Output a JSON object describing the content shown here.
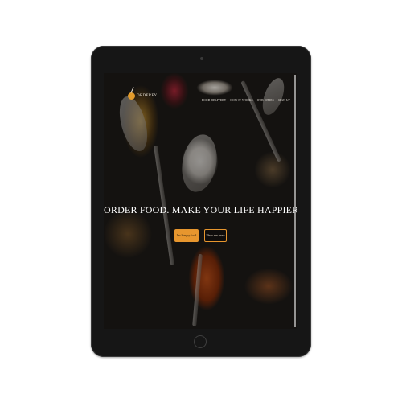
{
  "brand": {
    "name": "ORDERFY"
  },
  "nav": {
    "items": [
      "FOOD DELIVERY",
      "HOW IT WORKS",
      "OUR CITIES",
      "SIGN UP"
    ]
  },
  "hero": {
    "headline": "ORDER FOOD. MAKE YOUR LIFE HAPPIER!",
    "primary_button": "I'm hungry food",
    "secondary_button": "Show me more"
  },
  "colors": {
    "accent": "#e7962e",
    "device": "#161616"
  }
}
